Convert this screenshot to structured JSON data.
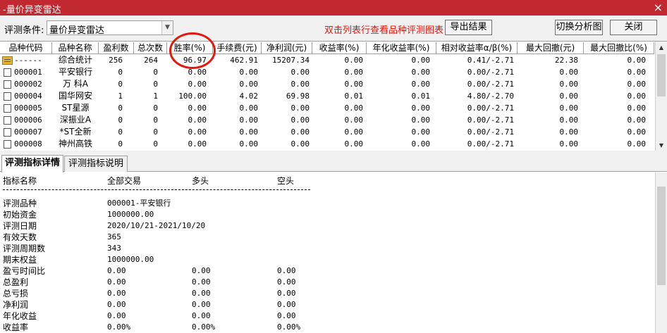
{
  "window": {
    "title": "-量价异变雷达",
    "close": "×"
  },
  "toolbar": {
    "condition_label": "评测条件:",
    "condition_value": "量价异变雷达",
    "hint": "双击列表行查看品种评测图表",
    "export_label": "导出结果",
    "switch_label": "切换分析图",
    "close_label": "关闭"
  },
  "table": {
    "headers": [
      "品种代码",
      "品种名称",
      "盈利数",
      "总次数",
      "胜率(%)",
      "手续费(元)",
      "净利润(元)",
      "收益率(%)",
      "年化收益率(%)",
      "相对收益率α/β(%)",
      "最大回撤(元)",
      "最大回撤比(%)"
    ],
    "rows": [
      [
        "------",
        "综合统计",
        "256",
        "264",
        "96.97",
        "462.91",
        "15207.34",
        "0.00",
        "0.00",
        "0.41/-2.71",
        "22.38",
        "0.00"
      ],
      [
        "000001",
        "平安银行",
        "0",
        "0",
        "0.00",
        "0.00",
        "0.00",
        "0.00",
        "0.00",
        "0.00/-2.71",
        "0.00",
        "0.00"
      ],
      [
        "000002",
        "万 科A",
        "0",
        "0",
        "0.00",
        "0.00",
        "0.00",
        "0.00",
        "0.00",
        "0.00/-2.71",
        "0.00",
        "0.00"
      ],
      [
        "000004",
        "国华网安",
        "1",
        "1",
        "100.00",
        "4.02",
        "69.98",
        "0.01",
        "0.01",
        "4.80/-2.70",
        "0.00",
        "0.00"
      ],
      [
        "000005",
        "ST星源",
        "0",
        "0",
        "0.00",
        "0.00",
        "0.00",
        "0.00",
        "0.00",
        "0.00/-2.71",
        "0.00",
        "0.00"
      ],
      [
        "000006",
        "深振业A",
        "0",
        "0",
        "0.00",
        "0.00",
        "0.00",
        "0.00",
        "0.00",
        "0.00/-2.71",
        "0.00",
        "0.00"
      ],
      [
        "000007",
        "*ST全新",
        "0",
        "0",
        "0.00",
        "0.00",
        "0.00",
        "0.00",
        "0.00",
        "0.00/-2.71",
        "0.00",
        "0.00"
      ],
      [
        "000008",
        "神州高铁",
        "0",
        "0",
        "0.00",
        "0.00",
        "0.00",
        "0.00",
        "0.00",
        "0.00/-2.71",
        "0.00",
        "0.00"
      ]
    ]
  },
  "tabs": [
    "评测指标详情",
    "评测指标说明"
  ],
  "detail": {
    "headers": [
      "指标名称",
      "全部交易",
      "多头",
      "空头"
    ],
    "lines": [
      [
        "评测品种",
        "000001-平安银行",
        "",
        ""
      ],
      [
        "初始资金",
        "1000000.00",
        "",
        ""
      ],
      [
        "评测日期",
        "2020/10/21-2021/10/20",
        "",
        ""
      ],
      [
        "有效天数",
        "365",
        "",
        ""
      ],
      [
        "评测周期数",
        "343",
        "",
        ""
      ],
      [
        "期末权益",
        "1000000.00",
        "",
        ""
      ],
      [
        "盈亏时间比",
        "0.00",
        "0.00",
        "0.00"
      ],
      [
        "总盈利",
        "0.00",
        "0.00",
        "0.00"
      ],
      [
        "总亏损",
        "0.00",
        "0.00",
        "0.00"
      ],
      [
        "净利润",
        "0.00",
        "0.00",
        "0.00"
      ],
      [
        "年化收益",
        "0.00",
        "0.00",
        "0.00"
      ],
      [
        "收益率",
        "0.00%",
        "0.00%",
        "0.00%"
      ]
    ]
  },
  "colors": {
    "titlebar": "#c1282f",
    "hint": "#e3170d",
    "annotation": "#e3170d"
  }
}
